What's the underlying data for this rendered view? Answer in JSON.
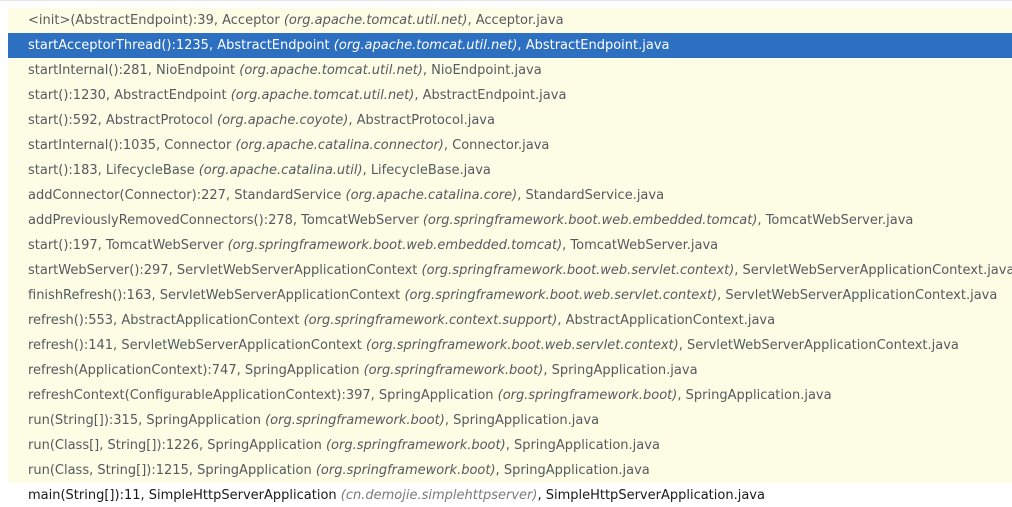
{
  "frames": [
    {
      "method": "<init>(AbstractEndpoint):39",
      "cls": "Acceptor",
      "pkg": "(org.apache.tomcat.util.net)",
      "file": "Acceptor.java"
    },
    {
      "method": "startAcceptorThread():1235",
      "cls": "AbstractEndpoint",
      "pkg": "(org.apache.tomcat.util.net)",
      "file": "AbstractEndpoint.java"
    },
    {
      "method": "startInternal():281",
      "cls": "NioEndpoint",
      "pkg": "(org.apache.tomcat.util.net)",
      "file": "NioEndpoint.java"
    },
    {
      "method": "start():1230",
      "cls": "AbstractEndpoint",
      "pkg": "(org.apache.tomcat.util.net)",
      "file": "AbstractEndpoint.java"
    },
    {
      "method": "start():592",
      "cls": "AbstractProtocol",
      "pkg": "(org.apache.coyote)",
      "file": "AbstractProtocol.java"
    },
    {
      "method": "startInternal():1035",
      "cls": "Connector",
      "pkg": "(org.apache.catalina.connector)",
      "file": "Connector.java"
    },
    {
      "method": "start():183",
      "cls": "LifecycleBase",
      "pkg": "(org.apache.catalina.util)",
      "file": "LifecycleBase.java"
    },
    {
      "method": "addConnector(Connector):227",
      "cls": "StandardService",
      "pkg": "(org.apache.catalina.core)",
      "file": "StandardService.java"
    },
    {
      "method": "addPreviouslyRemovedConnectors():278",
      "cls": "TomcatWebServer",
      "pkg": "(org.springframework.boot.web.embedded.tomcat)",
      "file": "TomcatWebServer.java"
    },
    {
      "method": "start():197",
      "cls": "TomcatWebServer",
      "pkg": "(org.springframework.boot.web.embedded.tomcat)",
      "file": "TomcatWebServer.java"
    },
    {
      "method": "startWebServer():297",
      "cls": "ServletWebServerApplicationContext",
      "pkg": "(org.springframework.boot.web.servlet.context)",
      "file": "ServletWebServerApplicationContext.java"
    },
    {
      "method": "finishRefresh():163",
      "cls": "ServletWebServerApplicationContext",
      "pkg": "(org.springframework.boot.web.servlet.context)",
      "file": "ServletWebServerApplicationContext.java"
    },
    {
      "method": "refresh():553",
      "cls": "AbstractApplicationContext",
      "pkg": "(org.springframework.context.support)",
      "file": "AbstractApplicationContext.java"
    },
    {
      "method": "refresh():141",
      "cls": "ServletWebServerApplicationContext",
      "pkg": "(org.springframework.boot.web.servlet.context)",
      "file": "ServletWebServerApplicationContext.java"
    },
    {
      "method": "refresh(ApplicationContext):747",
      "cls": "SpringApplication",
      "pkg": "(org.springframework.boot)",
      "file": "SpringApplication.java"
    },
    {
      "method": "refreshContext(ConfigurableApplicationContext):397",
      "cls": "SpringApplication",
      "pkg": "(org.springframework.boot)",
      "file": "SpringApplication.java"
    },
    {
      "method": "run(String[]):315",
      "cls": "SpringApplication",
      "pkg": "(org.springframework.boot)",
      "file": "SpringApplication.java"
    },
    {
      "method": "run(Class[], String[]):1226",
      "cls": "SpringApplication",
      "pkg": "(org.springframework.boot)",
      "file": "SpringApplication.java"
    },
    {
      "method": "run(Class, String[]):1215",
      "cls": "SpringApplication",
      "pkg": "(org.springframework.boot)",
      "file": "SpringApplication.java"
    },
    {
      "method": "main(String[]):11",
      "cls": "SimpleHttpServerApplication",
      "pkg": "(cn.demojie.simplehttpserver)",
      "file": "SimpleHttpServerApplication.java"
    }
  ],
  "selected_index": 1,
  "colors": {
    "library_frame_bg": "#fdfde6",
    "selected_bg": "#2d6fc0",
    "user_frame_bg": "#ffffff"
  }
}
